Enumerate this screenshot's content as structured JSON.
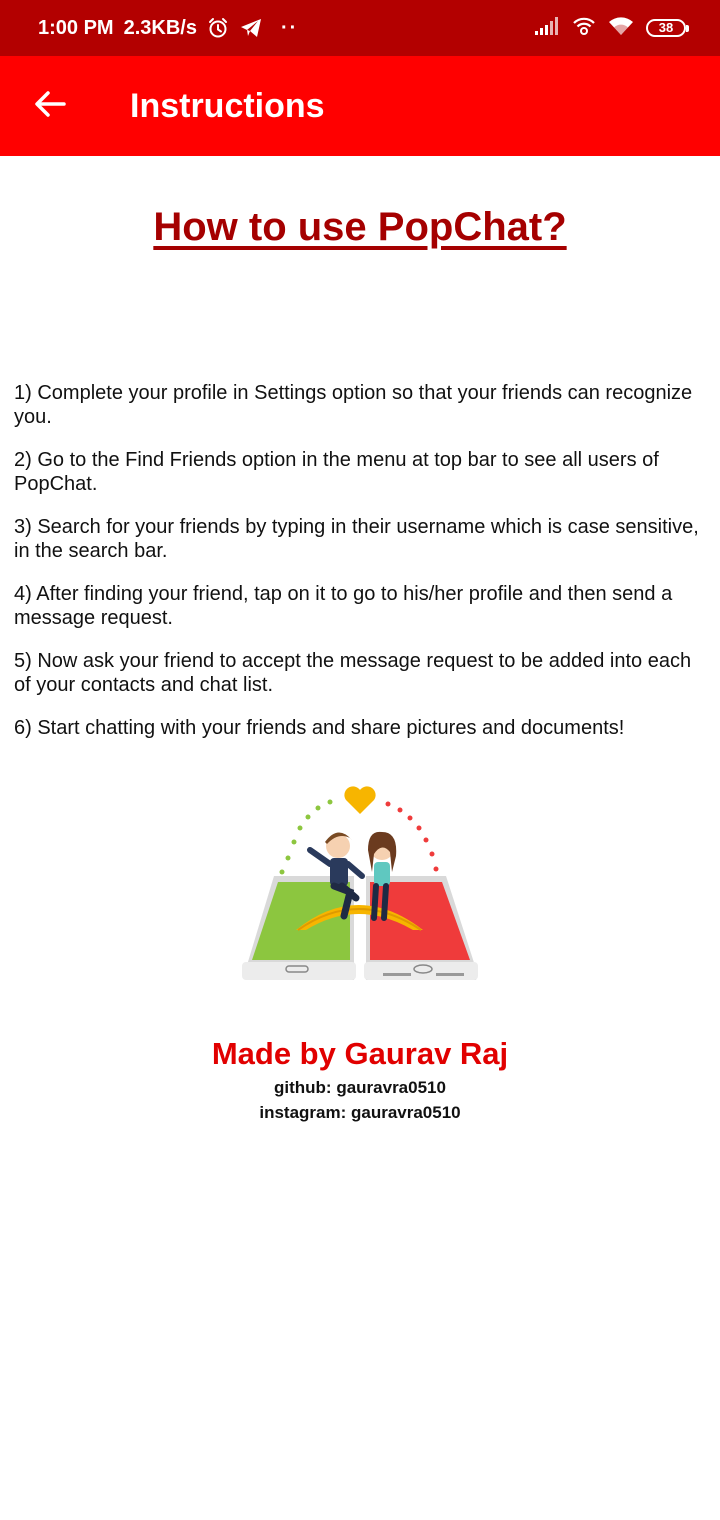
{
  "status_bar": {
    "time": "1:00 PM",
    "speed": "2.3KB/s",
    "battery": "38",
    "dots": "··"
  },
  "app_bar": {
    "title": "Instructions",
    "back_icon": "arrow-left-icon"
  },
  "content": {
    "heading": "How to use PopChat?",
    "steps": [
      "1) Complete your profile in Settings option so that your friends can recognize you.",
      "2) Go to the Find Friends option in the menu at top bar to see all users of PopChat.",
      "3) Search for your friends by typing in their username which is case sensitive, in the search bar.",
      "4) After finding your friend, tap on it to go to his/her profile and then send a message request.",
      "5) Now ask your friend to accept the message request to be added into each of your contacts and chat list.",
      "6) Start chatting with your friends and share pictures and documents!"
    ]
  },
  "footer": {
    "made_by": "Made by Gaurav Raj",
    "github": "github: gauravra0510",
    "instagram": "instagram: gauravra0510"
  },
  "colors": {
    "status_bar": "#b30000",
    "app_bar": "#ff0000",
    "heading": "#a50000",
    "credit": "#e10000"
  }
}
